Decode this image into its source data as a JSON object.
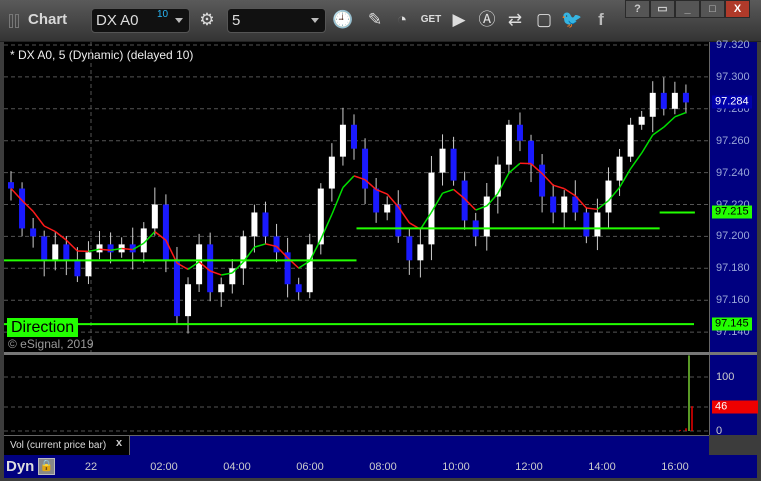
{
  "toolbar": {
    "title": "Chart",
    "symbol": "DX A0",
    "symbol_badge": "10",
    "interval": "5",
    "icons": [
      "settings-icon",
      "clock-icon",
      "pencil-icon",
      "study-icon",
      "get-icon",
      "play-icon",
      "alert-icon",
      "link-icon",
      "comment-icon",
      "twitter-icon",
      "facebook-icon"
    ],
    "window_buttons": [
      "?",
      "▭",
      "_",
      "□",
      "X"
    ]
  },
  "chart": {
    "legend": "* DX A0, 5 (Dynamic) (delayed 10)",
    "direction_label": "Direction",
    "copyright": "© eSignal, 2019",
    "price_labels": [
      "97.320",
      "97.300",
      "97.280",
      "97.260",
      "97.240",
      "97.220",
      "97.200",
      "97.180",
      "97.160",
      "97.140"
    ],
    "last_price": "97.284",
    "dyn_level": "97.215",
    "direction_level": "97.145",
    "colors": {
      "up": "#ffffff",
      "down": "#1a1aff",
      "ma_up": "#00e000",
      "ma_down": "#ff1a1a",
      "direction": "#22ff00"
    }
  },
  "chart_data": {
    "type": "candlestick",
    "ylim": [
      97.13,
      97.325
    ],
    "closes": [
      97.23,
      97.205,
      97.2,
      97.185,
      97.195,
      97.185,
      97.175,
      97.19,
      97.195,
      97.19,
      97.195,
      97.19,
      97.205,
      97.22,
      97.185,
      97.15,
      97.17,
      97.195,
      97.165,
      97.17,
      97.18,
      97.2,
      97.215,
      97.2,
      97.19,
      97.17,
      97.165,
      97.195,
      97.23,
      97.25,
      97.27,
      97.255,
      97.23,
      97.215,
      97.22,
      97.2,
      97.185,
      97.195,
      97.24,
      97.255,
      97.235,
      97.21,
      97.2,
      97.225,
      97.245,
      97.27,
      97.26,
      97.245,
      97.225,
      97.215,
      97.225,
      97.215,
      97.2,
      97.215,
      97.235,
      97.25,
      97.27,
      97.275,
      97.29,
      97.28,
      97.29,
      97.284
    ],
    "dyn_steps": [
      {
        "value": 97.185,
        "from": 0,
        "to": 0.5
      },
      {
        "value": 97.205,
        "from": 0.5,
        "to": 0.93
      },
      {
        "value": 97.215,
        "from": 0.93,
        "to": 0.98
      }
    ],
    "direction": 97.145
  },
  "volume": {
    "title": "Vol (current price bar)",
    "close_label": "x",
    "labels": [
      "100",
      "0"
    ],
    "current": "46",
    "bars": [
      2,
      0,
      5,
      140,
      46
    ]
  },
  "time_axis": {
    "mode": "Dyn",
    "labels": [
      "22",
      "02:00",
      "04:00",
      "06:00",
      "08:00",
      "10:00",
      "12:00",
      "14:00",
      "16:00"
    ]
  }
}
